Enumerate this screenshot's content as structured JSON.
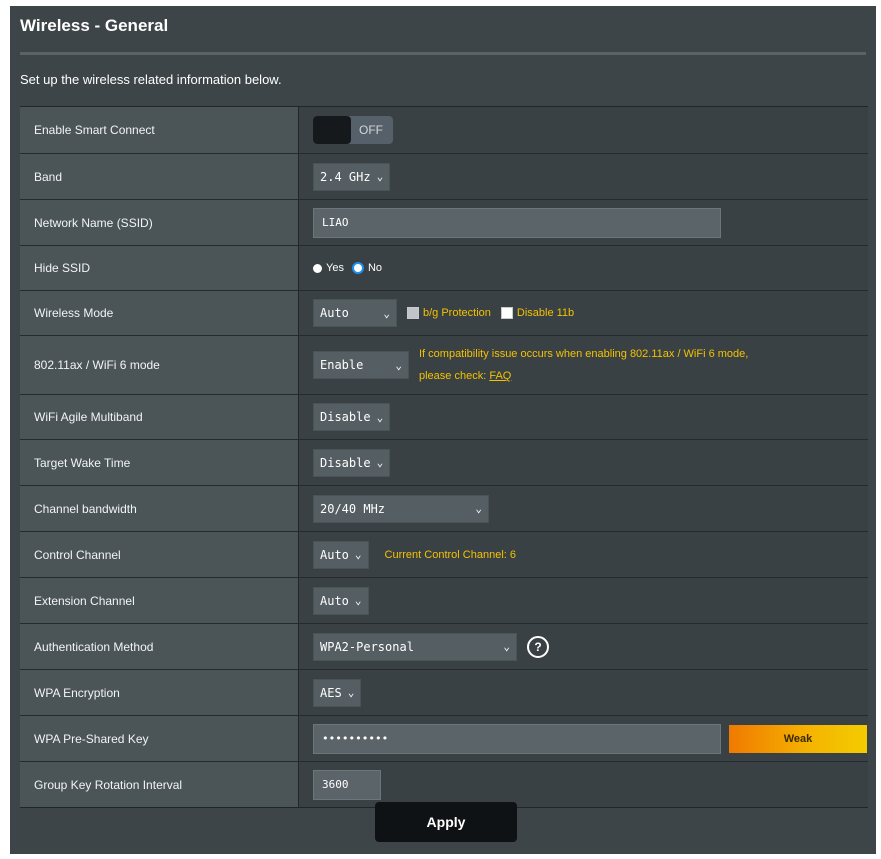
{
  "header": {
    "title": "Wireless - General",
    "subtitle": "Set up the wireless related information below."
  },
  "fields": {
    "smart_connect": {
      "label": "Enable Smart Connect",
      "state": "OFF"
    },
    "band": {
      "label": "Band",
      "value": "2.4 GHz"
    },
    "ssid": {
      "label": "Network Name (SSID)",
      "value": "LIAO"
    },
    "hide_ssid": {
      "label": "Hide SSID",
      "yes": "Yes",
      "no": "No",
      "selected": "No"
    },
    "wireless_mode": {
      "label": "Wireless Mode",
      "value": "Auto",
      "bg_protection": "b/g Protection",
      "disable_11b": "Disable 11b"
    },
    "wifi6": {
      "label": "802.11ax / WiFi 6 mode",
      "value": "Enable",
      "note_line1": "If compatibility issue occurs when enabling 802.11ax / WiFi 6 mode,",
      "note_line2": "please check:",
      "faq": "FAQ"
    },
    "agile_multiband": {
      "label": "WiFi Agile Multiband",
      "value": "Disable"
    },
    "target_wake_time": {
      "label": "Target Wake Time",
      "value": "Disable"
    },
    "channel_bandwidth": {
      "label": "Channel bandwidth",
      "value": "20/40 MHz"
    },
    "control_channel": {
      "label": "Control Channel",
      "value": "Auto",
      "current": "Current Control Channel: 6"
    },
    "extension_channel": {
      "label": "Extension Channel",
      "value": "Auto"
    },
    "auth_method": {
      "label": "Authentication Method",
      "value": "WPA2-Personal"
    },
    "wpa_encryption": {
      "label": "WPA Encryption",
      "value": "AES"
    },
    "psk": {
      "label": "WPA Pre-Shared Key",
      "value": "••••••••••",
      "strength": "Weak"
    },
    "group_key": {
      "label": "Group Key Rotation Interval",
      "value": "3600"
    }
  },
  "apply_label": "Apply",
  "colors": {
    "accent_yellow": "#f3c200",
    "panel": "#3e4548",
    "strength_weak": "#f07a00"
  },
  "icons": {
    "help": "help-icon",
    "chevron": "chevron-down-icon"
  }
}
